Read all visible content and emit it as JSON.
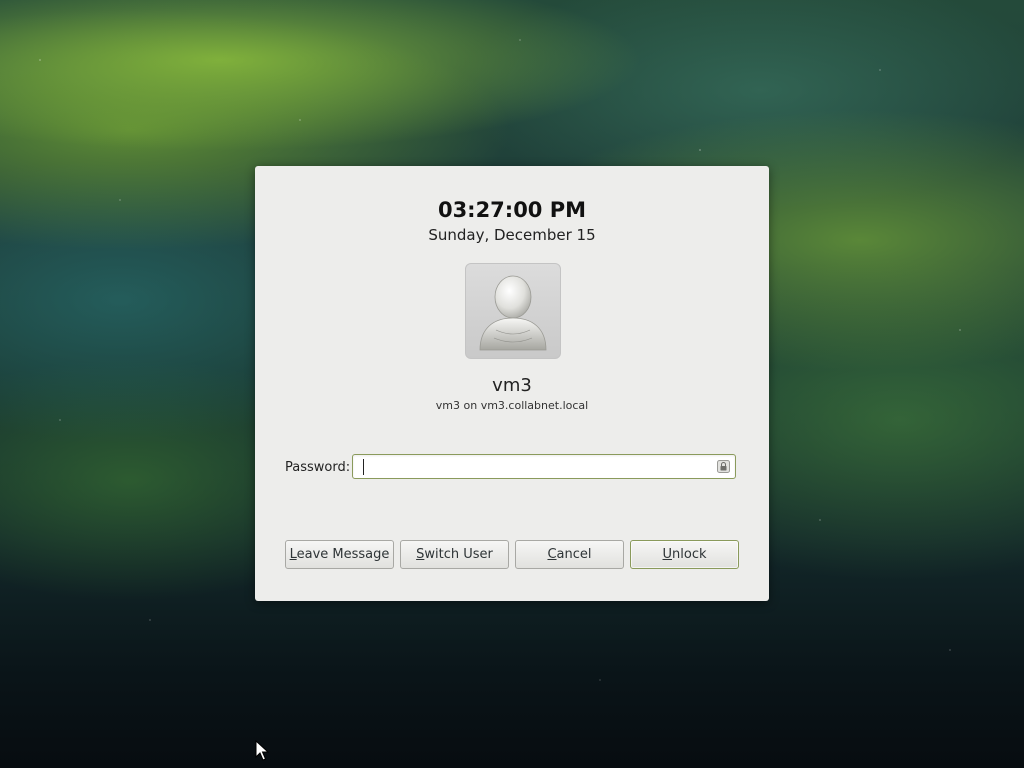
{
  "lock_dialog": {
    "time": "03:27:00 PM",
    "date": "Sunday, December 15",
    "username": "vm3",
    "realm": "vm3 on vm3.collabnet.local",
    "password_label": "Password:",
    "password_value": "",
    "icons": {
      "avatar": "user-avatar-icon",
      "lock": "lock-icon",
      "cursor": "mouse-pointer-icon"
    },
    "buttons": {
      "leave_message": {
        "mnemonic": "L",
        "rest": "eave Message"
      },
      "switch_user": {
        "mnemonic": "S",
        "rest": "witch User"
      },
      "cancel": {
        "mnemonic": "C",
        "rest": "ancel"
      },
      "unlock": {
        "mnemonic": "U",
        "rest": "nlock"
      }
    }
  },
  "colors": {
    "dialog_bg": "#ededeb",
    "focus_border": "#8a9a5b",
    "button_border": "#a8a8a4",
    "text": "#2e3436"
  }
}
